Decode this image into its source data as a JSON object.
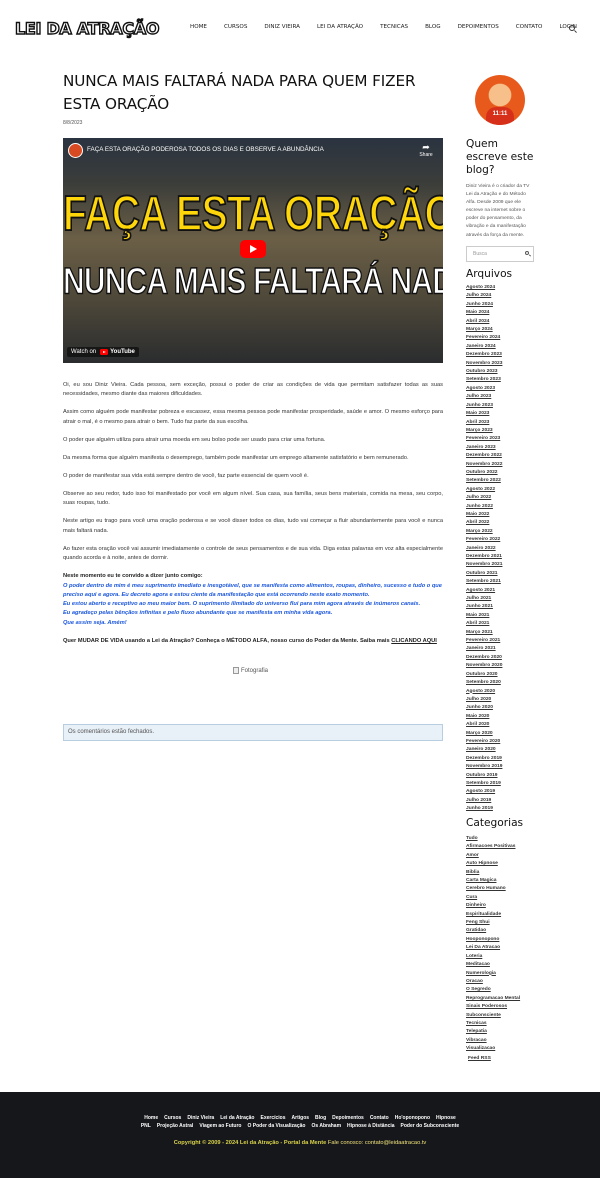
{
  "site": {
    "logo": "LEI DA ATRAÇÃO"
  },
  "nav": {
    "items": [
      "Home",
      "CURSOS",
      "DINIZ VIEIRA",
      "LEI DA ATRAÇÃO",
      "TECNICAS",
      "BLOG",
      "DEPOIMENTOS",
      "CONTATO",
      "LOGIN"
    ]
  },
  "post": {
    "title": "NUNCA MAIS FALTARÁ NADA PARA QUEM FIZER ESTA ORAÇÃO",
    "date": "8/8/2023",
    "video": {
      "title": "FAÇA ESTA ORAÇÃO PODEROSA TODOS OS DIAS E OBSERVE A ABUNDÂNCIA",
      "share": "Share",
      "line1": "FAÇA ESTA ORAÇÃO",
      "line2": "NUNCA MAIS FALTARÁ NADA",
      "watch_on": "Watch on",
      "youtube": "YouTube"
    },
    "paragraphs": [
      "Oi, eu sou Diniz Vieira. Cada pessoa, sem exceção, possui o poder de criar as condições de vida que permitam satisfazer todas as suas necessidades, mesmo diante das maiores dificuldades.",
      "Assim como alguém pode manifestar pobreza e escassez, essa mesma pessoa pode manifestar prosperidade, saúde e amor. O mesmo esforço para atrair o mal, é o mesmo para atrair o bem. Tudo faz parte da sua escolha.",
      "O poder que alguém utiliza para atrair uma moeda em seu bolso pode ser usado para criar uma fortuna.",
      "Da mesma forma que alguém manifesta o desemprego, também pode manifestar um emprego altamente satisfatório e bem remunerado.",
      "O poder de manifestar sua vida está sempre dentro de você, faz parte essencial de quem você é.",
      "Observe ao seu redor, tudo isso foi manifestado por você em algum nível. Sua casa, sua família, seus bens materiais, comida na mesa, seu corpo, suas roupas, tudo.",
      "Neste artigo eu trago para você uma oração poderosa e se você disser todos os dias, tudo vai começar a fluir abundantemente para você e nunca mais faltará nada.",
      "Ao fazer esta oração você vai assumir imediatamente o controle de seus pensamentos e de sua vida. Diga estas palavras em voz alta especialmente quando acorda e à noite, antes de dormir."
    ],
    "prayer_heading": "Neste momento eu te convido a dizer junto comigo:",
    "prayer_lines": [
      "O poder dentro de mim é meu suprimento imediato e inesgotável, que se manifesta como alimentos, roupas, dinheiro, sucesso e tudo o que preciso aqui e agora. Eu decreto agora e estou ciente da manifestação que está ocorrendo neste exato momento.",
      "Eu estou aberto e receptivo ao meu maior bem. O suprimento ilimitado do universo flui para mim agora através de inúmeros canais.",
      "Eu agradeço pelas bênçãos infinitas e pelo fluxo abundante que se manifesta em minha vida agora.",
      "Que assim seja. Amém!"
    ],
    "cta_text": "Quer MUDAR DE VIDA usando a Lei da Atração? Conheça o MÉTODO ALFA, nosso curso do Poder da Mente. Saiba mais",
    "cta_link": "CLICANDO AQUI",
    "image_alt": "Fotografia",
    "comments_closed": "Os comentários estão fechados."
  },
  "sidebar": {
    "author_badge": "11:11",
    "author_title": "Quem escreve este blog?",
    "author_bio": "Diniz Vieira é o criador da TV Lei da Atração e do Método Alfa. Desde 2009 que ele escreve na internet sobre o poder do pensamento, da vibração e da manifestação através da força da mente.",
    "search_placeholder": "Busca",
    "archives_title": "Arquivos",
    "archives": [
      "Agosto 2024",
      "Julho 2024",
      "Junho 2024",
      "Maio 2024",
      "Abril 2024",
      "Março 2024",
      "Fevereiro 2024",
      "Janeiro 2024",
      "Dezembro 2023",
      "Novembro 2023",
      "Outubro 2023",
      "Setembro 2023",
      "Agosto 2023",
      "Julho 2023",
      "Junho 2023",
      "Maio 2023",
      "Abril 2023",
      "Março 2023",
      "Fevereiro 2023",
      "Janeiro 2023",
      "Dezembro 2022",
      "Novembro 2022",
      "Outubro 2022",
      "Setembro 2022",
      "Agosto 2022",
      "Julho 2022",
      "Junho 2022",
      "Maio 2022",
      "Abril 2022",
      "Março 2022",
      "Fevereiro 2022",
      "Janeiro 2022",
      "Dezembro 2021",
      "Novembro 2021",
      "Outubro 2021",
      "Setembro 2021",
      "Agosto 2021",
      "Julho 2021",
      "Junho 2021",
      "Maio 2021",
      "Abril 2021",
      "Março 2021",
      "Fevereiro 2021",
      "Janeiro 2021",
      "Dezembro 2020",
      "Novembro 2020",
      "Outubro 2020",
      "Setembro 2020",
      "Agosto 2020",
      "Julho 2020",
      "Junho 2020",
      "Maio 2020",
      "Abril 2020",
      "Março 2020",
      "Fevereiro 2020",
      "Janeiro 2020",
      "Dezembro 2019",
      "Novembro 2019",
      "Outubro 2019",
      "Setembro 2019",
      "Agosto 2019",
      "Julho 2019",
      "Junho 2019"
    ],
    "categories_title": "Categorias",
    "categories": [
      "Tudo",
      "Afirmacoes Positivas",
      "Amor",
      "Auto Hipnose",
      "Biblia",
      "Carta Magica",
      "Cerebro Humano",
      "Cura",
      "Dinheiro",
      "Espiritualidade",
      "Feng Shui",
      "Gratidao",
      "Hooponopono",
      "Lei Da Atracao",
      "Loteria",
      "Meditacao",
      "Numerologia",
      "Oracao",
      "O Segredo",
      "Reprogramacao Mental",
      "Sinais Poderosos",
      "Subconsciente",
      "Tecnicas",
      "Telepatia",
      "Vibracao",
      "Visualizacao"
    ],
    "feed": "Feed RSS"
  },
  "footer": {
    "row1": [
      "Home",
      "Cursos",
      "Diniz Vieira",
      "Lei da Atração",
      "Exercícios",
      "Artigos",
      "Blog",
      "Depoimentos",
      "Contato",
      "Ho'oponopono",
      "Hipnose"
    ],
    "row2": [
      "PNL",
      "Projeção Astral",
      "Viagem ao Futuro",
      "O Poder da Visualização",
      "Os Abraham",
      "Hipnose à Distância",
      "Poder do Subconsciente"
    ],
    "copyright": "Copyright © 2009 - 2024 Lei da Atração - Portal da Mente",
    "contact": "Fale conosco: contato@leidaatracao.tv"
  }
}
